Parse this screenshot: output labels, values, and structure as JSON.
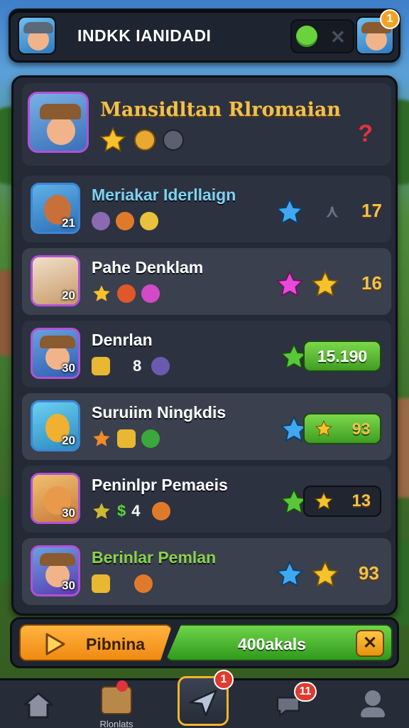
{
  "topbar": {
    "title": "INDKK IANIDADI",
    "notification_count": "1"
  },
  "header": {
    "player_name": "Mansidltan Rlromaian",
    "help_symbol": "?"
  },
  "rows": [
    {
      "name": "Meriakar Iderllaign",
      "level": "21",
      "value": "17"
    },
    {
      "name": "Pahe Denklam",
      "level": "20",
      "value": "16"
    },
    {
      "name": "Denrlan",
      "level": "30",
      "value": "15.190",
      "stat": "8"
    },
    {
      "name": "Suruiim Ningkdis",
      "level": "20",
      "value": "93"
    },
    {
      "name": "Peninlpr Pemaeis",
      "level": "30",
      "value": "13",
      "stat": "4"
    },
    {
      "name": "Berinlar Pemlan",
      "level": "30",
      "value": "93"
    }
  ],
  "actions": {
    "play_label": "Pibnina",
    "green_label": "400akals"
  },
  "nav": {
    "item2_label": "Rlonlats",
    "center_badge": "1",
    "chat_badge": "11"
  },
  "colors": {
    "accent_gold": "#f3c04a",
    "green": "#5ad23c",
    "orange": "#f08a12",
    "panel": "#232935"
  }
}
